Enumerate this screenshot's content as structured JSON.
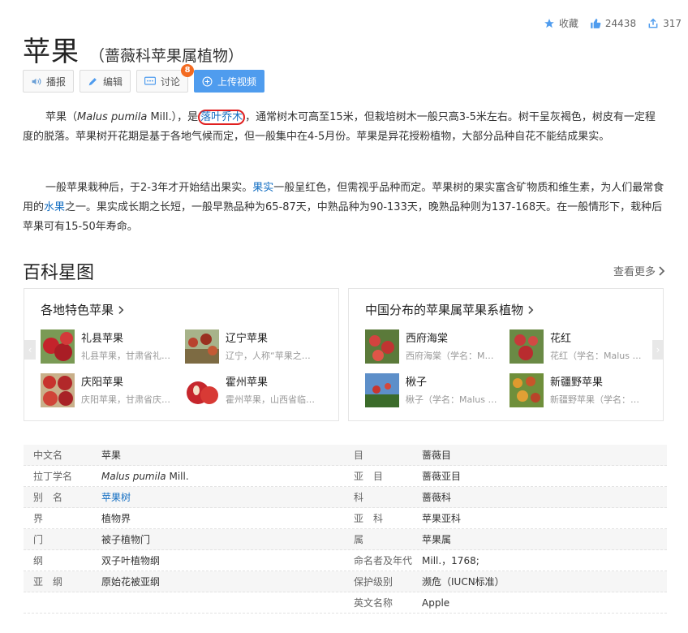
{
  "stats": {
    "favorite_label": "收藏",
    "likes": "24438",
    "shares": "317"
  },
  "title": "苹果",
  "subtitle": "（蔷薇科苹果属植物）",
  "toolbar": {
    "broadcast": "播报",
    "edit": "编辑",
    "discuss": "讨论",
    "discuss_count": "8",
    "upload": "上传视频"
  },
  "intro": {
    "p1_a": "苹果（",
    "p1_latin": "Malus pumila",
    "p1_b": " Mill.），是",
    "p1_link": "落叶乔木",
    "p1_c": "，通常树木可高至15米，但栽培树木一般只高3-5米左右。树干呈灰褐色，树皮有一定程度的脱落。苹果树开花期是基于各地气候而定，但一般集中在4-5月份。苹果是异花授粉植物，大部分品种自花不能结成果实。",
    "p2_a": "一般苹果栽种后，于2-3年才开始结出果实。",
    "p2_link1": "果实",
    "p2_b": "一般呈红色，但需视乎品种而定。苹果树的果实富含矿物质和维生素，为人们最常食用的",
    "p2_link2": "水果",
    "p2_c": "之一。果实成长期之长短，一般早熟品种为65-87天，中熟品种为90-133天，晚熟品种则为137-168天。在一般情形下，栽种后苹果可有15-50年寿命。"
  },
  "gallery": {
    "title": "百科星图",
    "see_more": "查看更多",
    "cards": [
      {
        "title": "各地特色苹果",
        "items": [
          {
            "name": "礼县苹果",
            "desc": "礼县苹果，甘肃省礼…"
          },
          {
            "name": "辽宁苹果",
            "desc": "辽宁，人称“苹果之…"
          },
          {
            "name": "庆阳苹果",
            "desc": "庆阳苹果，甘肃省庆…"
          },
          {
            "name": "霍州苹果",
            "desc": "霍州苹果，山西省临…"
          }
        ]
      },
      {
        "title": "中国分布的苹果属苹果系植物",
        "items": [
          {
            "name": "西府海棠",
            "desc": "西府海棠（学名：M…"
          },
          {
            "name": "花红",
            "desc": "花红（学名：Malus …"
          },
          {
            "name": "楸子",
            "desc": "楸子（学名：Malus …"
          },
          {
            "name": "新疆野苹果",
            "desc": "新疆野苹果（学名：…"
          }
        ]
      }
    ]
  },
  "info_left": [
    {
      "k": "中文名",
      "v": "苹果"
    },
    {
      "k": "拉丁学名",
      "v_latin": "Malus pumila",
      "v": " Mill."
    },
    {
      "k": "别　名",
      "v_link": "苹果树"
    },
    {
      "k": "界",
      "v": "植物界"
    },
    {
      "k": "门",
      "v": "被子植物门"
    },
    {
      "k": "纲",
      "v": "双子叶植物纲"
    },
    {
      "k": "亚　纲",
      "v": "原始花被亚纲"
    }
  ],
  "info_right": [
    {
      "k": "目",
      "v": "蔷薇目"
    },
    {
      "k": "亚　目",
      "v": "蔷薇亚目"
    },
    {
      "k": "科",
      "v": "蔷薇科"
    },
    {
      "k": "亚　科",
      "v": "苹果亚科"
    },
    {
      "k": "属",
      "v": "苹果属"
    },
    {
      "k": "命名者及年代",
      "v": "Mill.，1768;"
    },
    {
      "k": "保护级别",
      "v": "濒危（IUCN标准）"
    },
    {
      "k": "英文名称",
      "v": "Apple"
    }
  ],
  "colors": {
    "link": "#136ec2",
    "primary": "#4f9cee",
    "badge": "#f36b21",
    "circle": "#e02020"
  },
  "icons": [
    "star-icon",
    "thumbs-up-icon",
    "share-icon",
    "speaker-icon",
    "pencil-icon",
    "chat-icon",
    "plus-circle-icon",
    "chevron-right-icon"
  ]
}
